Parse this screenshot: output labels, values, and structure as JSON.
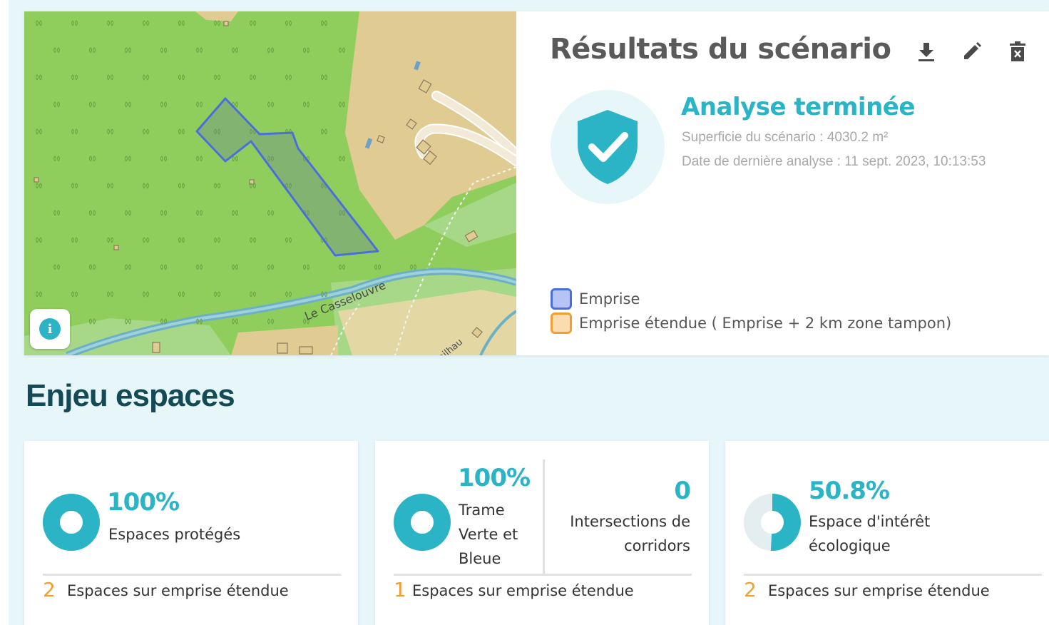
{
  "map": {
    "river_label": "Le Casselouvre",
    "stream_label": "arailhau",
    "info_icon": "info-icon"
  },
  "results": {
    "title": "Résultats du scénario",
    "icons": [
      "download-icon",
      "edit-icon",
      "delete-icon"
    ],
    "status": "Analyse terminée",
    "area_line": "Superficie du scénario : 4030.2 m²",
    "date_line": "Date de dernière analyse : 11 sept. 2023, 10:13:53",
    "legend": [
      {
        "label": "Emprise",
        "fill": "#b5c4f5",
        "border": "#4a6fdc"
      },
      {
        "label": "Emprise étendue ( Emprise + 2 km zone tampon)",
        "fill": "#fbdcb1",
        "border": "#f0a032"
      }
    ],
    "accent": "#2bb3c6"
  },
  "section": {
    "title": "Enjeu espaces"
  },
  "cards": [
    {
      "percent_text": "100%",
      "percent": 100,
      "label": "Espaces protégés",
      "count": "2",
      "count_label": "Espaces sur emprise étendue"
    },
    {
      "percent_text": "100%",
      "percent": 100,
      "label_lines": [
        "Trame",
        "Verte et",
        "Bleue"
      ],
      "intersections_value": "0",
      "intersections_lines": [
        "Intersections de",
        "corridors"
      ],
      "count": "1",
      "count_label": "Espaces sur emprise étendue"
    },
    {
      "percent_text": "50.8%",
      "percent": 50.8,
      "label_lines": [
        "Espace d'intérêt",
        "écologique"
      ],
      "count": "2",
      "count_label": "Espaces sur emprise étendue"
    }
  ]
}
